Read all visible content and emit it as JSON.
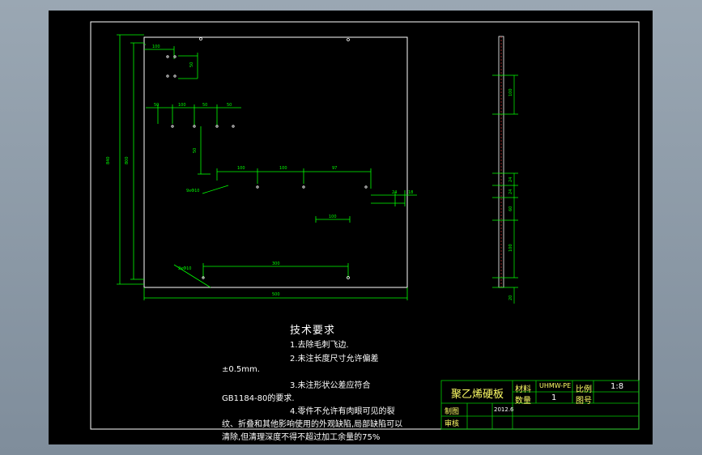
{
  "colors": {
    "outline": "#ffffff",
    "dimension": "#00ff00",
    "hidden": "#ff4444",
    "note": "#ffff66",
    "titleblock": "#00cc00"
  },
  "technical_requirements": {
    "title": "技术要求",
    "lines": [
      "1.去除毛刺飞边.",
      "2.未注长度尺寸允许偏差",
      "±0.5mm.",
      "3.未注形状公差应符合",
      "GB1184-80的要求.",
      "4.零件不允许有肉眼可见的裂",
      "纹、折叠和其他影响使用的外观缺陷,局部缺陷可以",
      "清除,但清理深度不得不超过加工余量的75%"
    ]
  },
  "title_block": {
    "part_name": "聚乙烯硬板",
    "material_label": "材料",
    "material_value": "UHMW-PE",
    "scale_label": "比例",
    "scale_value": "1:8",
    "qty_label": "数量",
    "qty_value": "1",
    "drawing_no_label": "图号",
    "drafter_label": "制图",
    "date_value": "2012.6",
    "checker_label": "审核"
  }
}
